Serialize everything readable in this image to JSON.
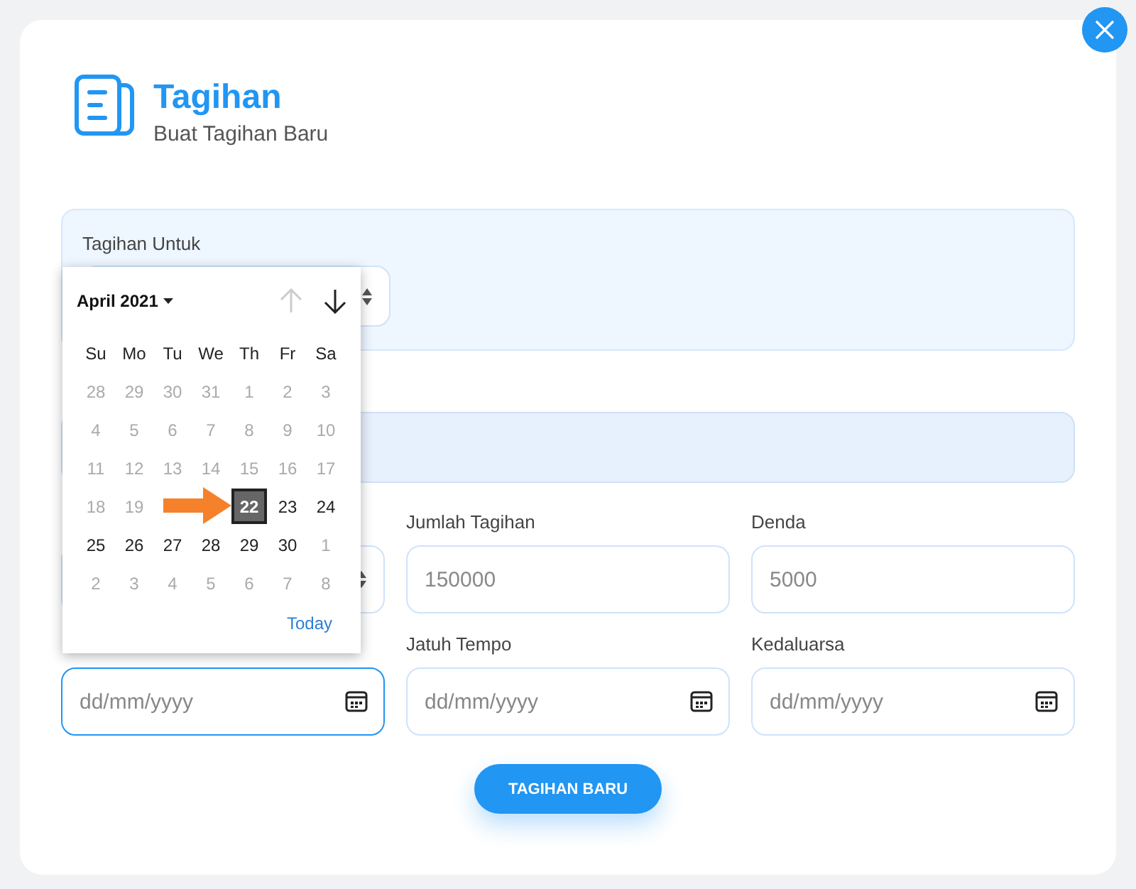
{
  "header": {
    "title": "Tagihan",
    "subtitle": "Buat Tagihan Baru"
  },
  "recipient": {
    "label": "Tagihan Untuk"
  },
  "amount_row": [
    {
      "kind": "select"
    },
    {
      "kind": "text",
      "label": "Jumlah Tagihan",
      "placeholder": "150000"
    },
    {
      "kind": "text",
      "label": "Denda",
      "placeholder": "5000"
    }
  ],
  "date_row": [
    {
      "kind": "date",
      "placeholder": "dd/mm/yyyy",
      "focused": true
    },
    {
      "kind": "date",
      "label": "Jatuh Tempo",
      "placeholder": "dd/mm/yyyy",
      "focused": false
    },
    {
      "kind": "date",
      "label": "Kedaluarsa",
      "placeholder": "dd/mm/yyyy",
      "focused": false
    }
  ],
  "date_picker": {
    "month": "April 2021",
    "prev_disabled": true,
    "weekdays": [
      "Su",
      "Mo",
      "Tu",
      "We",
      "Th",
      "Fr",
      "Sa"
    ],
    "weeks": [
      [
        {
          "kind": "day",
          "label": "28",
          "muted": true,
          "selected": false
        },
        {
          "kind": "day",
          "label": "29",
          "muted": true,
          "selected": false
        },
        {
          "kind": "day",
          "label": "30",
          "muted": true,
          "selected": false
        },
        {
          "kind": "day",
          "label": "31",
          "muted": true,
          "selected": false
        },
        {
          "kind": "day",
          "label": "1",
          "muted": true,
          "selected": false
        },
        {
          "kind": "day",
          "label": "2",
          "muted": true,
          "selected": false
        },
        {
          "kind": "day",
          "label": "3",
          "muted": true,
          "selected": false
        }
      ],
      [
        {
          "kind": "day",
          "label": "4",
          "muted": true,
          "selected": false
        },
        {
          "kind": "day",
          "label": "5",
          "muted": true,
          "selected": false
        },
        {
          "kind": "day",
          "label": "6",
          "muted": true,
          "selected": false
        },
        {
          "kind": "day",
          "label": "7",
          "muted": true,
          "selected": false
        },
        {
          "kind": "day",
          "label": "8",
          "muted": true,
          "selected": false
        },
        {
          "kind": "day",
          "label": "9",
          "muted": true,
          "selected": false
        },
        {
          "kind": "day",
          "label": "10",
          "muted": true,
          "selected": false
        }
      ],
      [
        {
          "kind": "day",
          "label": "11",
          "muted": true,
          "selected": false
        },
        {
          "kind": "day",
          "label": "12",
          "muted": true,
          "selected": false
        },
        {
          "kind": "day",
          "label": "13",
          "muted": true,
          "selected": false
        },
        {
          "kind": "day",
          "label": "14",
          "muted": true,
          "selected": false
        },
        {
          "kind": "day",
          "label": "15",
          "muted": true,
          "selected": false
        },
        {
          "kind": "day",
          "label": "16",
          "muted": true,
          "selected": false
        },
        {
          "kind": "day",
          "label": "17",
          "muted": true,
          "selected": false
        }
      ],
      [
        {
          "kind": "day",
          "label": "18",
          "muted": true,
          "selected": false
        },
        {
          "kind": "day",
          "label": "19",
          "muted": true,
          "selected": false
        },
        {
          "kind": "covered"
        },
        {
          "kind": "covered"
        },
        {
          "kind": "day",
          "label": "22",
          "muted": false,
          "selected": true
        },
        {
          "kind": "day",
          "label": "23",
          "muted": false,
          "selected": false
        },
        {
          "kind": "day",
          "label": "24",
          "muted": false,
          "selected": false
        }
      ],
      [
        {
          "kind": "day",
          "label": "25",
          "muted": false,
          "selected": false
        },
        {
          "kind": "day",
          "label": "26",
          "muted": false,
          "selected": false
        },
        {
          "kind": "day",
          "label": "27",
          "muted": false,
          "selected": false
        },
        {
          "kind": "day",
          "label": "28",
          "muted": false,
          "selected": false
        },
        {
          "kind": "day",
          "label": "29",
          "muted": false,
          "selected": false
        },
        {
          "kind": "day",
          "label": "30",
          "muted": false,
          "selected": false
        },
        {
          "kind": "day",
          "label": "1",
          "muted": true,
          "selected": false
        }
      ],
      [
        {
          "kind": "day",
          "label": "2",
          "muted": true,
          "selected": false
        },
        {
          "kind": "day",
          "label": "3",
          "muted": true,
          "selected": false
        },
        {
          "kind": "day",
          "label": "4",
          "muted": true,
          "selected": false
        },
        {
          "kind": "day",
          "label": "5",
          "muted": true,
          "selected": false
        },
        {
          "kind": "day",
          "label": "6",
          "muted": true,
          "selected": false
        },
        {
          "kind": "day",
          "label": "7",
          "muted": true,
          "selected": false
        },
        {
          "kind": "day",
          "label": "8",
          "muted": true,
          "selected": false
        }
      ]
    ],
    "today": "Today"
  },
  "submit_button": "TAGIHAN BARU"
}
